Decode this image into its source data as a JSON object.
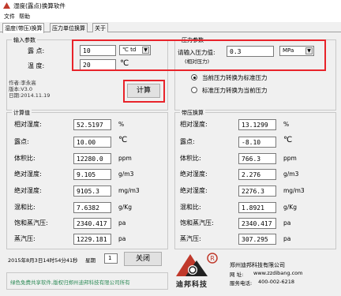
{
  "window": {
    "title": "湿度(露点)换算软件"
  },
  "menu": {
    "file": "文件",
    "help": "帮助"
  },
  "tabs": [
    "湿度(带压)换算",
    "压力单位换算",
    "关于"
  ],
  "input_group": {
    "title": "输入参数",
    "dewpoint_label": "露 点:",
    "dewpoint_value": "10",
    "dewpoint_unit_select": "℃ td",
    "temp_label": "温 度:",
    "temp_value": "20",
    "temp_unit": "℃"
  },
  "author_info": [
    "作者:李永高",
    "版本:V3.0",
    "日期:2014.11.19"
  ],
  "compute_button": "计算",
  "pressure_group": {
    "title": "压力参数",
    "prompt": "请输入压力值:",
    "note": "(相对压力)",
    "value": "0.3",
    "unit_select": "MPa",
    "radio1": "当前压力转换为标准压力",
    "radio2": "标准压力转换为当前压力"
  },
  "calc_group": {
    "title": "计算值",
    "rows": [
      {
        "label": "相对湿度:",
        "value": "52.5197",
        "unit": "%"
      },
      {
        "label": "露点:",
        "value": "10.00",
        "unit": "℃"
      },
      {
        "label": "体积比:",
        "value": "12280.0",
        "unit": "ppm"
      },
      {
        "label": "绝对湿度:",
        "value": "9.105",
        "unit": "g/m3"
      },
      {
        "label": "绝对湿度:",
        "value": "9105.3",
        "unit": "mg/m3"
      },
      {
        "label": "混和比:",
        "value": "7.6382",
        "unit": "g/Kg"
      },
      {
        "label": "饱和蒸汽压:",
        "value": "2340.417",
        "unit": "pa"
      },
      {
        "label": "蒸汽压:",
        "value": "1229.181",
        "unit": "pa"
      }
    ]
  },
  "pressure_calc_group": {
    "title": "带压换算",
    "rows": [
      {
        "label": "相对湿度:",
        "value": "13.1299",
        "unit": "%"
      },
      {
        "label": "露点:",
        "value": "-8.10",
        "unit": "℃"
      },
      {
        "label": "体积比:",
        "value": "766.3",
        "unit": "ppm"
      },
      {
        "label": "绝对湿度:",
        "value": "2.276",
        "unit": "g/m3"
      },
      {
        "label": "绝对湿度:",
        "value": "2276.3",
        "unit": "mg/m3"
      },
      {
        "label": "混和比:",
        "value": "1.8921",
        "unit": "g/Kg"
      },
      {
        "label": "饱和蒸汽压:",
        "value": "2340.417",
        "unit": "pa"
      },
      {
        "label": "蒸汽压:",
        "value": "307.295",
        "unit": "pa"
      }
    ]
  },
  "footer": {
    "datetime": "2015年8月3日14时54分41秒",
    "week_label": "星期",
    "week_value": "1",
    "close_button": "关闭",
    "brand_text": "迪邦科技",
    "company": "郑州迪邦科技有限公司",
    "website_label": "网  址:",
    "website": "www.zzdibang.com",
    "phone_label": "服务电话:",
    "phone": "400-002-6218",
    "notice": "绿色免费共享软件,版权归郑州迪邦科技有限公司所有",
    "colors": {
      "red_highlight": "#e8232a",
      "notice_green": "#2e8b57",
      "brand_red": "#c0392b"
    }
  }
}
